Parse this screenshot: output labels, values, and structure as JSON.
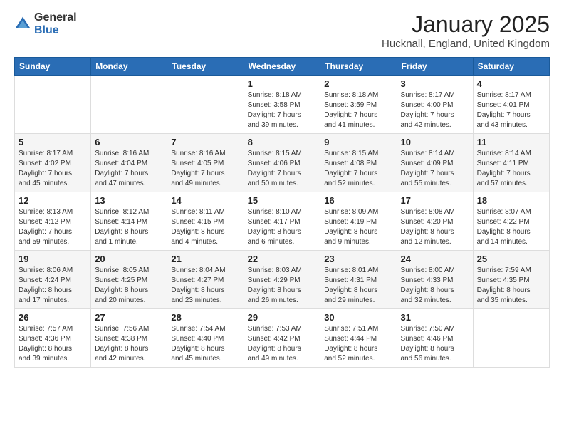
{
  "logo": {
    "general": "General",
    "blue": "Blue"
  },
  "header": {
    "title": "January 2025",
    "location": "Hucknall, England, United Kingdom"
  },
  "days_of_week": [
    "Sunday",
    "Monday",
    "Tuesday",
    "Wednesday",
    "Thursday",
    "Friday",
    "Saturday"
  ],
  "weeks": [
    [
      {
        "day": "",
        "info": ""
      },
      {
        "day": "",
        "info": ""
      },
      {
        "day": "",
        "info": ""
      },
      {
        "day": "1",
        "info": "Sunrise: 8:18 AM\nSunset: 3:58 PM\nDaylight: 7 hours\nand 39 minutes."
      },
      {
        "day": "2",
        "info": "Sunrise: 8:18 AM\nSunset: 3:59 PM\nDaylight: 7 hours\nand 41 minutes."
      },
      {
        "day": "3",
        "info": "Sunrise: 8:17 AM\nSunset: 4:00 PM\nDaylight: 7 hours\nand 42 minutes."
      },
      {
        "day": "4",
        "info": "Sunrise: 8:17 AM\nSunset: 4:01 PM\nDaylight: 7 hours\nand 43 minutes."
      }
    ],
    [
      {
        "day": "5",
        "info": "Sunrise: 8:17 AM\nSunset: 4:02 PM\nDaylight: 7 hours\nand 45 minutes."
      },
      {
        "day": "6",
        "info": "Sunrise: 8:16 AM\nSunset: 4:04 PM\nDaylight: 7 hours\nand 47 minutes."
      },
      {
        "day": "7",
        "info": "Sunrise: 8:16 AM\nSunset: 4:05 PM\nDaylight: 7 hours\nand 49 minutes."
      },
      {
        "day": "8",
        "info": "Sunrise: 8:15 AM\nSunset: 4:06 PM\nDaylight: 7 hours\nand 50 minutes."
      },
      {
        "day": "9",
        "info": "Sunrise: 8:15 AM\nSunset: 4:08 PM\nDaylight: 7 hours\nand 52 minutes."
      },
      {
        "day": "10",
        "info": "Sunrise: 8:14 AM\nSunset: 4:09 PM\nDaylight: 7 hours\nand 55 minutes."
      },
      {
        "day": "11",
        "info": "Sunrise: 8:14 AM\nSunset: 4:11 PM\nDaylight: 7 hours\nand 57 minutes."
      }
    ],
    [
      {
        "day": "12",
        "info": "Sunrise: 8:13 AM\nSunset: 4:12 PM\nDaylight: 7 hours\nand 59 minutes."
      },
      {
        "day": "13",
        "info": "Sunrise: 8:12 AM\nSunset: 4:14 PM\nDaylight: 8 hours\nand 1 minute."
      },
      {
        "day": "14",
        "info": "Sunrise: 8:11 AM\nSunset: 4:15 PM\nDaylight: 8 hours\nand 4 minutes."
      },
      {
        "day": "15",
        "info": "Sunrise: 8:10 AM\nSunset: 4:17 PM\nDaylight: 8 hours\nand 6 minutes."
      },
      {
        "day": "16",
        "info": "Sunrise: 8:09 AM\nSunset: 4:19 PM\nDaylight: 8 hours\nand 9 minutes."
      },
      {
        "day": "17",
        "info": "Sunrise: 8:08 AM\nSunset: 4:20 PM\nDaylight: 8 hours\nand 12 minutes."
      },
      {
        "day": "18",
        "info": "Sunrise: 8:07 AM\nSunset: 4:22 PM\nDaylight: 8 hours\nand 14 minutes."
      }
    ],
    [
      {
        "day": "19",
        "info": "Sunrise: 8:06 AM\nSunset: 4:24 PM\nDaylight: 8 hours\nand 17 minutes."
      },
      {
        "day": "20",
        "info": "Sunrise: 8:05 AM\nSunset: 4:25 PM\nDaylight: 8 hours\nand 20 minutes."
      },
      {
        "day": "21",
        "info": "Sunrise: 8:04 AM\nSunset: 4:27 PM\nDaylight: 8 hours\nand 23 minutes."
      },
      {
        "day": "22",
        "info": "Sunrise: 8:03 AM\nSunset: 4:29 PM\nDaylight: 8 hours\nand 26 minutes."
      },
      {
        "day": "23",
        "info": "Sunrise: 8:01 AM\nSunset: 4:31 PM\nDaylight: 8 hours\nand 29 minutes."
      },
      {
        "day": "24",
        "info": "Sunrise: 8:00 AM\nSunset: 4:33 PM\nDaylight: 8 hours\nand 32 minutes."
      },
      {
        "day": "25",
        "info": "Sunrise: 7:59 AM\nSunset: 4:35 PM\nDaylight: 8 hours\nand 35 minutes."
      }
    ],
    [
      {
        "day": "26",
        "info": "Sunrise: 7:57 AM\nSunset: 4:36 PM\nDaylight: 8 hours\nand 39 minutes."
      },
      {
        "day": "27",
        "info": "Sunrise: 7:56 AM\nSunset: 4:38 PM\nDaylight: 8 hours\nand 42 minutes."
      },
      {
        "day": "28",
        "info": "Sunrise: 7:54 AM\nSunset: 4:40 PM\nDaylight: 8 hours\nand 45 minutes."
      },
      {
        "day": "29",
        "info": "Sunrise: 7:53 AM\nSunset: 4:42 PM\nDaylight: 8 hours\nand 49 minutes."
      },
      {
        "day": "30",
        "info": "Sunrise: 7:51 AM\nSunset: 4:44 PM\nDaylight: 8 hours\nand 52 minutes."
      },
      {
        "day": "31",
        "info": "Sunrise: 7:50 AM\nSunset: 4:46 PM\nDaylight: 8 hours\nand 56 minutes."
      },
      {
        "day": "",
        "info": ""
      }
    ]
  ]
}
